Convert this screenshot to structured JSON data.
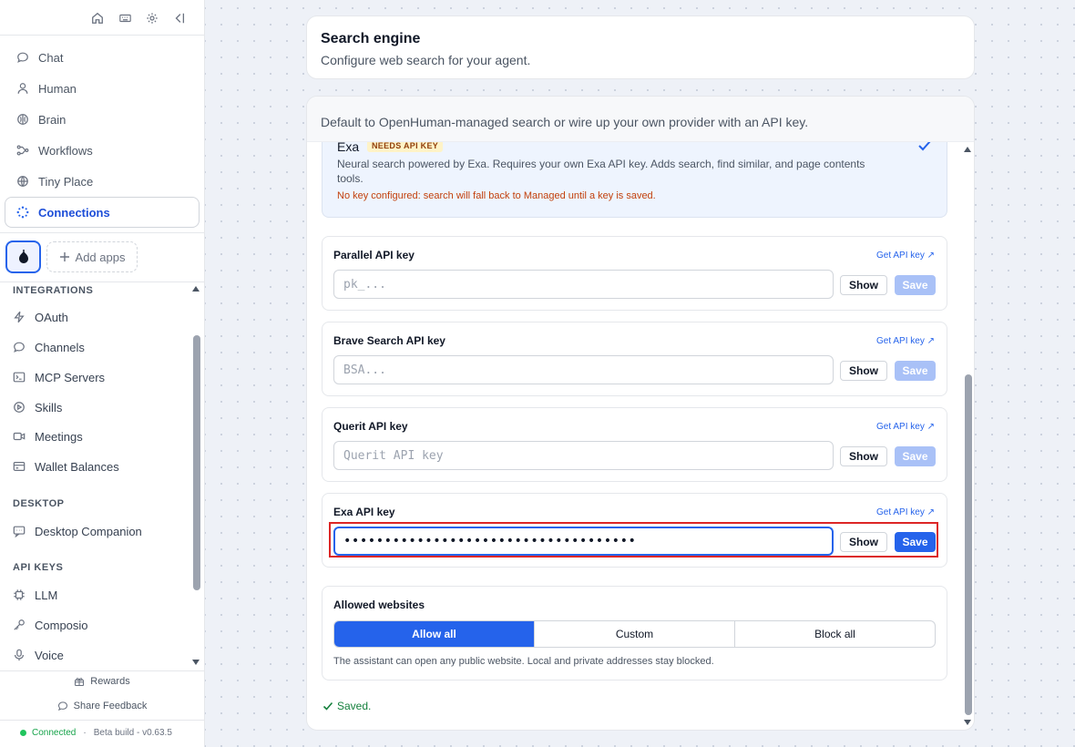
{
  "sidebar": {
    "top_icons": [
      "home-icon",
      "keyboard-icon",
      "gear-icon",
      "collapse-icon"
    ],
    "nav": [
      {
        "label": "Chat",
        "icon": "chat-bubble-icon"
      },
      {
        "label": "Human",
        "icon": "person-icon"
      },
      {
        "label": "Brain",
        "icon": "brain-icon"
      },
      {
        "label": "Workflows",
        "icon": "workflow-icon"
      },
      {
        "label": "Tiny Place",
        "icon": "globe-icon"
      },
      {
        "label": "Connections",
        "icon": "connections-icon",
        "active": true
      }
    ],
    "add_apps_label": "Add apps",
    "sections": {
      "integrations": {
        "title": "INTEGRATIONS",
        "items": [
          {
            "label": "OAuth",
            "icon": "bolt-icon"
          },
          {
            "label": "Channels",
            "icon": "chat-bubble-icon"
          },
          {
            "label": "MCP Servers",
            "icon": "terminal-icon"
          },
          {
            "label": "Skills",
            "icon": "play-circle-icon"
          },
          {
            "label": "Meetings",
            "icon": "video-icon"
          },
          {
            "label": "Wallet Balances",
            "icon": "wallet-icon"
          }
        ]
      },
      "desktop": {
        "title": "DESKTOP",
        "items": [
          {
            "label": "Desktop Companion",
            "icon": "chat-bubble-icon"
          }
        ]
      },
      "api_keys": {
        "title": "API KEYS",
        "items": [
          {
            "label": "LLM",
            "icon": "chip-icon"
          },
          {
            "label": "Composio",
            "icon": "key-icon"
          },
          {
            "label": "Voice",
            "icon": "microphone-icon"
          }
        ]
      }
    },
    "footer": {
      "rewards": "Rewards",
      "share_feedback": "Share Feedback",
      "status": "Connected",
      "separator": "·",
      "build": "Beta build - v0.63.5",
      "status_color": "#22c55e"
    }
  },
  "header": {
    "title": "Search engine",
    "subtitle": "Configure web search for your agent."
  },
  "main": {
    "intro": "Default to OpenHuman-managed search or wire up your own provider with an API key.",
    "exa_option": {
      "name": "Exa",
      "badge": "NEEDS API KEY",
      "description": "Neural search powered by Exa. Requires your own Exa API key. Adds search, find similar, and page contents tools.",
      "warning": "No key configured: search will fall back to Managed until a key is saved.",
      "selected": true
    },
    "key_cards": [
      {
        "label": "Parallel API key",
        "link": "Get API key ↗",
        "placeholder": "pk_...",
        "value": "",
        "show": "Show",
        "save": "Save",
        "save_enabled": false
      },
      {
        "label": "Brave Search API key",
        "link": "Get API key ↗",
        "placeholder": "BSA...",
        "value": "",
        "show": "Show",
        "save": "Save",
        "save_enabled": false
      },
      {
        "label": "Querit API key",
        "link": "Get API key ↗",
        "placeholder": "Querit API key",
        "value": "",
        "show": "Show",
        "save": "Save",
        "save_enabled": false
      },
      {
        "label": "Exa API key",
        "link": "Get API key ↗",
        "placeholder": "",
        "value": "••••••••••••••••••••••••••••••••••••",
        "show": "Show",
        "save": "Save",
        "save_enabled": true,
        "focused": true
      }
    ],
    "allowed_websites": {
      "title": "Allowed websites",
      "options": [
        "Allow all",
        "Custom",
        "Block all"
      ],
      "selected": "Allow all",
      "note": "The assistant can open any public website. Local and private addresses stay blocked."
    },
    "saved_message": "Saved.",
    "colors": {
      "accent": "#2563eb",
      "highlight": "#dc2626",
      "warning": "#c2410c",
      "success": "#15803d"
    }
  }
}
